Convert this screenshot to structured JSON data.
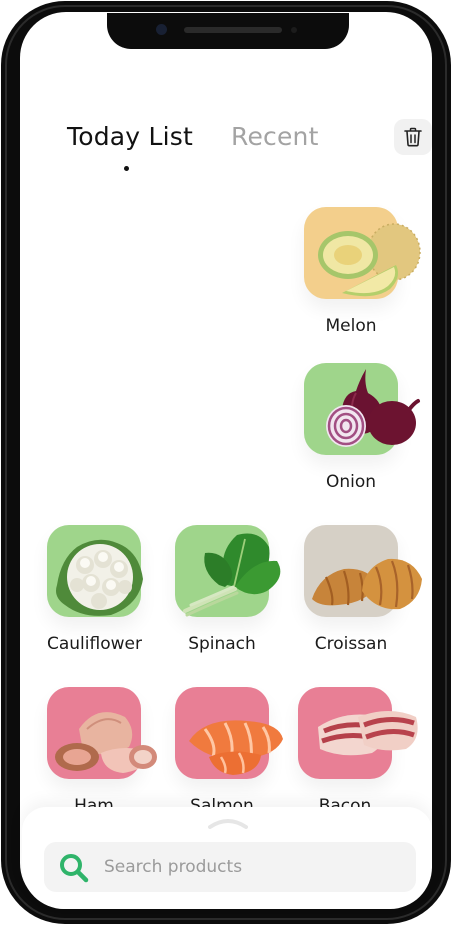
{
  "tabs": [
    {
      "label": "Today List",
      "active": true
    },
    {
      "label": "Recent",
      "active": false
    }
  ],
  "toolbar": {
    "delete_icon": "trash-icon"
  },
  "today_list": [
    {
      "name": "Melon",
      "tile_color": "#f3cf8c",
      "icon": "melon-icon"
    },
    {
      "name": "Onion",
      "tile_color": "#9fd58b",
      "icon": "onion-icon"
    },
    {
      "name": "Cauliflower",
      "tile_color": "#9fd58b",
      "icon": "cauliflower-icon"
    },
    {
      "name": "Spinach",
      "tile_color": "#9fd58b",
      "icon": "spinach-icon"
    },
    {
      "name": "Croissan",
      "tile_color": "#d6d0c6",
      "icon": "croissant-icon"
    },
    {
      "name": "Ham",
      "tile_color": "#e87f95",
      "icon": "ham-icon"
    },
    {
      "name": "Salmon",
      "tile_color": "#e87f95",
      "icon": "salmon-icon"
    },
    {
      "name": "Bacon",
      "tile_color": "#e87f95",
      "icon": "bacon-icon"
    }
  ],
  "search": {
    "placeholder": "Search products",
    "icon_color": "#2fb46a"
  }
}
